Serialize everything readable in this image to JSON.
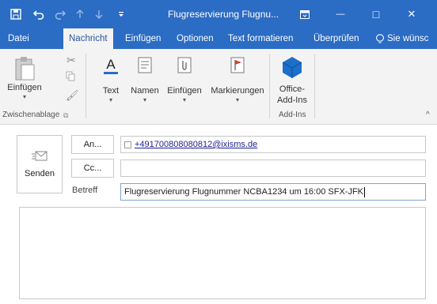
{
  "titlebar": {
    "title": "Flugreservierung Flugnu...",
    "minimize": "—",
    "maximize": "□",
    "close": "✕"
  },
  "tabs": [
    {
      "label": "Datei"
    },
    {
      "label": "Nachricht"
    },
    {
      "label": "Einfügen"
    },
    {
      "label": "Optionen"
    },
    {
      "label": "Text formatieren"
    },
    {
      "label": "Überprüfen"
    },
    {
      "label": "Sie wünsc"
    }
  ],
  "ribbon": {
    "einfuegen": "Einfügen",
    "text": "Text",
    "namen": "Namen",
    "einfuegen2": "Einfügen",
    "markierungen": "Markierungen",
    "office_addins": [
      "Office-",
      "Add-Ins"
    ],
    "group_zwischenablage": "Zwischenablage",
    "group_addins": "Add-Ins"
  },
  "compose": {
    "send_label": "Senden",
    "to_label": "An...",
    "cc_label": "Cc...",
    "subject_label": "Betreff",
    "to_value": "+491700808080812@ixisms.de",
    "cc_value": "",
    "subject_value": "Flugreservierung Flugnummer NCBA1234 um 16:00 SFX-JFK"
  }
}
